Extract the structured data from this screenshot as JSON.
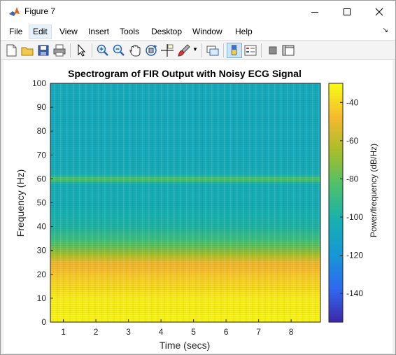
{
  "window": {
    "title": "Figure 7",
    "controls": {
      "minimize": "minimize",
      "maximize": "maximize",
      "close": "close"
    }
  },
  "menu": {
    "items": [
      "File",
      "Edit",
      "View",
      "Insert",
      "Tools",
      "Desktop",
      "Window",
      "Help"
    ],
    "active": "Edit"
  },
  "toolbar": {
    "buttons": [
      {
        "name": "new-figure-icon"
      },
      {
        "name": "open-file-icon"
      },
      {
        "name": "save-icon"
      },
      {
        "name": "print-icon"
      },
      {
        "name": "edit-plot-arrow-icon"
      },
      {
        "name": "zoom-in-icon"
      },
      {
        "name": "zoom-out-icon"
      },
      {
        "name": "pan-hand-icon"
      },
      {
        "name": "rotate-3d-icon"
      },
      {
        "name": "data-cursor-icon"
      },
      {
        "name": "brush-icon"
      },
      {
        "name": "link-plot-icon"
      },
      {
        "name": "colorbar-toggle-icon",
        "active": true
      },
      {
        "name": "legend-toggle-icon"
      },
      {
        "name": "hide-plot-tools-icon"
      },
      {
        "name": "show-plot-tools-icon"
      }
    ]
  },
  "chart_data": {
    "type": "heatmap",
    "title": "Spectrogram of FIR Output with Noisy ECG Signal",
    "xlabel": "Time (secs)",
    "ylabel": "Frequency (Hz)",
    "xlim": [
      0.6,
      8.9
    ],
    "ylim": [
      0,
      100
    ],
    "xticks": [
      1,
      2,
      3,
      4,
      5,
      6,
      7,
      8
    ],
    "yticks": [
      0,
      10,
      20,
      30,
      40,
      50,
      60,
      70,
      80,
      90,
      100
    ],
    "colorbar": {
      "label": "Power/frequency (dB/Hz)",
      "range": [
        -155,
        -30
      ],
      "ticks": [
        -40,
        -60,
        -80,
        -100,
        -120,
        -140
      ],
      "colormap": "parula",
      "colors": [
        "#3e26a8",
        "#2f6af0",
        "#1598d6",
        "#17b0b0",
        "#4ac16d",
        "#a5be2a",
        "#f5b92e",
        "#f9fb14"
      ]
    },
    "frequency_profile_db": [
      {
        "freq": 0,
        "db": -32
      },
      {
        "freq": 10,
        "db": -34
      },
      {
        "freq": 20,
        "db": -44
      },
      {
        "freq": 25,
        "db": -50
      },
      {
        "freq": 30,
        "db": -72
      },
      {
        "freq": 35,
        "db": -88
      },
      {
        "freq": 40,
        "db": -98
      },
      {
        "freq": 50,
        "db": -104
      },
      {
        "freq": 58,
        "db": -104
      },
      {
        "freq": 60,
        "db": -78
      },
      {
        "freq": 62,
        "db": -104
      },
      {
        "freq": 70,
        "db": -106
      },
      {
        "freq": 100,
        "db": -106
      }
    ],
    "grid": false
  }
}
